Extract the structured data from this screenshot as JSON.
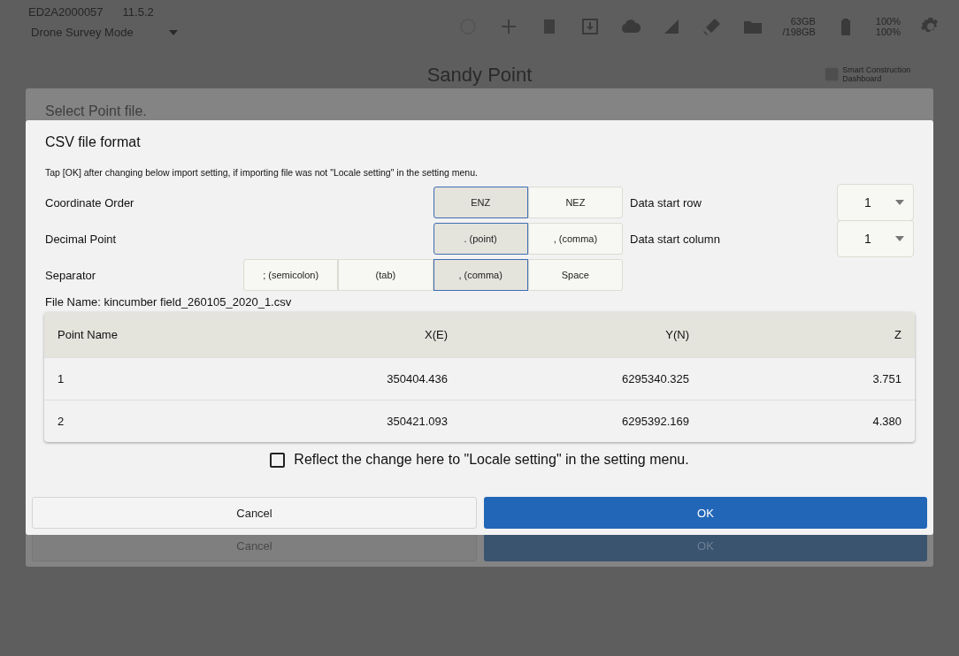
{
  "background": {
    "device_id": "ED2A2000057",
    "version": "11.5.2",
    "mode": "Drone Survey Mode",
    "project_title": "Sandy Point",
    "storage": [
      "63GB",
      "/198GB"
    ],
    "battery": [
      "100%",
      "100%"
    ],
    "dashboard_label": "Smart Construction Dashboard"
  },
  "behind_dialog": {
    "title": "Select Point file.",
    "buttons": [
      {
        "label": "Cancel",
        "kind": "secondary"
      },
      {
        "label": "OK",
        "kind": "primary"
      }
    ]
  },
  "dialog": {
    "title": "CSV file format",
    "note": "Tap [OK] after changing below import setting, if importing file was not \"Locale setting\" in the setting menu.",
    "settings": [
      {
        "label": "Coordinate Order",
        "options": [
          {
            "label": "ENZ",
            "selected": true
          },
          {
            "label": "NEZ",
            "selected": false
          }
        ],
        "side_field": {
          "label": "Data start row",
          "value": "1"
        }
      },
      {
        "label": "Decimal Point",
        "options": [
          {
            "label": ". (point)",
            "selected": true
          },
          {
            "label": ", (comma)",
            "selected": false
          }
        ],
        "side_field": {
          "label": "Data start column",
          "value": "1"
        }
      },
      {
        "label": "Separator",
        "options": [
          {
            "label": "; (semicolon)",
            "selected": false
          },
          {
            "label": "(tab)",
            "selected": false
          },
          {
            "label": ", (comma)",
            "selected": true
          },
          {
            "label": "Space",
            "selected": false
          }
        ]
      }
    ],
    "file_name": "File Name: kincumber field_260105_2020_1.csv",
    "table": {
      "columns": [
        "Point Name",
        "X(E)",
        "Y(N)",
        "Z"
      ],
      "rows": [
        [
          "1",
          "350404.436",
          "6295340.325",
          "3.751"
        ],
        [
          "2",
          "350421.093",
          "6295392.169",
          "4.380"
        ]
      ]
    },
    "reflect_checkbox": {
      "label": "Reflect the change here to \"Locale setting\" in the setting menu.",
      "checked": false
    },
    "buttons": [
      {
        "label": "Cancel",
        "kind": "secondary"
      },
      {
        "label": "OK",
        "kind": "primary"
      }
    ]
  }
}
